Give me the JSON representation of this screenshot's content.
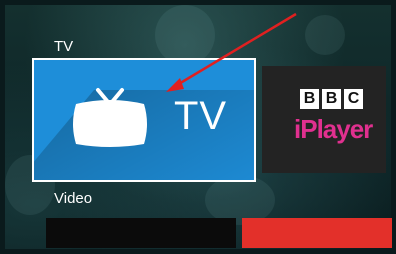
{
  "rows": [
    {
      "label": "TV"
    },
    {
      "label": "Video"
    }
  ],
  "tv_card": {
    "title": "TV",
    "icon": "tv-icon",
    "color": "#1e8ed9"
  },
  "bbc_card": {
    "logo_blocks": [
      "B",
      "B",
      "C"
    ],
    "product": "iPlayer",
    "product_color": "#e0308f"
  },
  "video_tiles": [
    {
      "color": "#0b0b0b"
    },
    {
      "color": "#e3302a"
    }
  ],
  "annotation": {
    "type": "arrow",
    "color": "#e02020"
  }
}
